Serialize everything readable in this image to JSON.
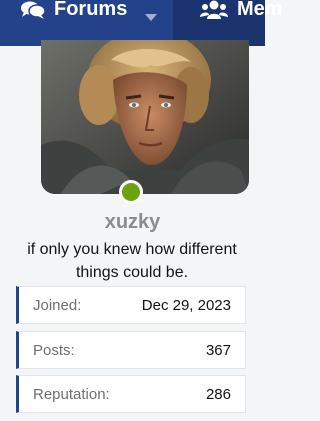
{
  "nav": {
    "forums_label": "Forums",
    "members_label": "Mem"
  },
  "profile": {
    "username": "xuzky",
    "tagline": "if only you knew how different things could be.",
    "online_color": "#6aa30c"
  },
  "stats": [
    {
      "label": "Joined:",
      "value": "Dec 29, 2023"
    },
    {
      "label": "Posts:",
      "value": "367"
    },
    {
      "label": "Reputation:",
      "value": "286"
    }
  ],
  "colors": {
    "nav_bg": "#23428a",
    "accent": "#23428a",
    "username": "#8c8c8c"
  }
}
